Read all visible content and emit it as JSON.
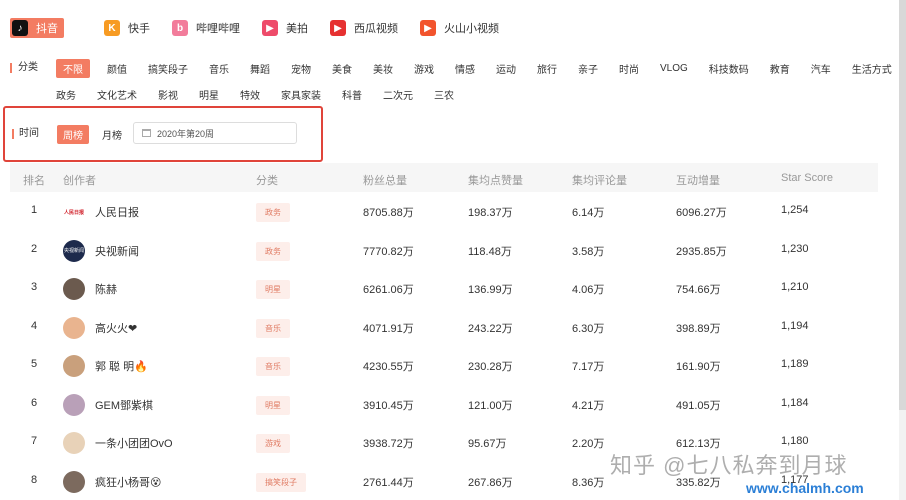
{
  "platforms": [
    {
      "label": "抖音",
      "icon": "douyin-icon",
      "color": "#111111",
      "glyph": "♪"
    },
    {
      "label": "快手",
      "icon": "kuaishou-icon",
      "color": "#f79b23",
      "glyph": "K"
    },
    {
      "label": "哔哩哔哩",
      "icon": "bilibili-icon",
      "color": "#f27c9b",
      "glyph": "b"
    },
    {
      "label": "美拍",
      "icon": "meipai-icon",
      "color": "#ee4b6a",
      "glyph": "▶"
    },
    {
      "label": "西瓜视频",
      "icon": "xigua-icon",
      "color": "#e63131",
      "glyph": "▶"
    },
    {
      "label": "火山小视频",
      "icon": "huoshan-icon",
      "color": "#f2542d",
      "glyph": "▶"
    }
  ],
  "categories": {
    "title": "分类",
    "row1": [
      "不限",
      "颜值",
      "搞笑段子",
      "音乐",
      "舞蹈",
      "宠物",
      "美食",
      "美妆",
      "游戏",
      "情感",
      "运动",
      "旅行",
      "亲子",
      "时尚",
      "VLOG",
      "科技数码",
      "教育",
      "汽车",
      "生活方式"
    ],
    "row2": [
      "政务",
      "文化艺术",
      "影视",
      "明星",
      "特效",
      "家具家装",
      "科普",
      "二次元",
      "三农"
    ]
  },
  "time": {
    "label": "时间",
    "weekly": "周榜",
    "monthly": "月榜",
    "date_value": "2020年第20周"
  },
  "table": {
    "headers": [
      "排名",
      "创作者",
      "分类",
      "粉丝总量",
      "集均点赞量",
      "集均评论量",
      "互动增量",
      "Star Score"
    ],
    "rows": [
      {
        "rank": "1",
        "name": "人民日报",
        "tag": "政务",
        "fans": "8705.88万",
        "likes": "198.37万",
        "comments": "6.14万",
        "interact": "6096.27万",
        "score": "1,254",
        "avatar_color": "#ffffff",
        "avatar_text": "人民日报"
      },
      {
        "rank": "2",
        "name": "央视新闻",
        "tag": "政务",
        "fans": "7770.82万",
        "likes": "118.48万",
        "comments": "3.58万",
        "interact": "2935.85万",
        "score": "1,230",
        "avatar_color": "#1d2a4c",
        "avatar_text": "央视新闻"
      },
      {
        "rank": "3",
        "name": "陈赫",
        "tag": "明星",
        "fans": "6261.06万",
        "likes": "136.99万",
        "comments": "4.06万",
        "interact": "754.66万",
        "score": "1,210",
        "avatar_color": "#6b5a4e",
        "avatar_text": ""
      },
      {
        "rank": "4",
        "name": "高火火❤",
        "tag": "音乐",
        "fans": "4071.91万",
        "likes": "243.22万",
        "comments": "6.30万",
        "interact": "398.89万",
        "score": "1,194",
        "avatar_color": "#e9b48f",
        "avatar_text": ""
      },
      {
        "rank": "5",
        "name": "郭 聪 明🔥",
        "tag": "音乐",
        "fans": "4230.55万",
        "likes": "230.28万",
        "comments": "7.17万",
        "interact": "161.90万",
        "score": "1,189",
        "avatar_color": "#c9a07c",
        "avatar_text": ""
      },
      {
        "rank": "6",
        "name": "GEM鄧紫棋",
        "tag": "明星",
        "fans": "3910.45万",
        "likes": "121.00万",
        "comments": "4.21万",
        "interact": "491.05万",
        "score": "1,184",
        "avatar_color": "#b9a0b8",
        "avatar_text": ""
      },
      {
        "rank": "7",
        "name": "一条小团团OvO",
        "tag": "游戏",
        "fans": "3938.72万",
        "likes": "95.67万",
        "comments": "2.20万",
        "interact": "612.13万",
        "score": "1,180",
        "avatar_color": "#e8d2b8",
        "avatar_text": ""
      },
      {
        "rank": "8",
        "name": "疯狂小杨哥😵",
        "tag": "搞笑段子",
        "fans": "2761.44万",
        "likes": "267.86万",
        "comments": "8.36万",
        "interact": "335.82万",
        "score": "1,177",
        "avatar_color": "#7c6a5e",
        "avatar_text": ""
      }
    ]
  },
  "watermark": {
    "text": "知乎 @七八私奔到月球",
    "url": "www.chalmh.com"
  },
  "colors": {
    "accent": "#f37c62",
    "highlight_border": "#e0443a"
  }
}
